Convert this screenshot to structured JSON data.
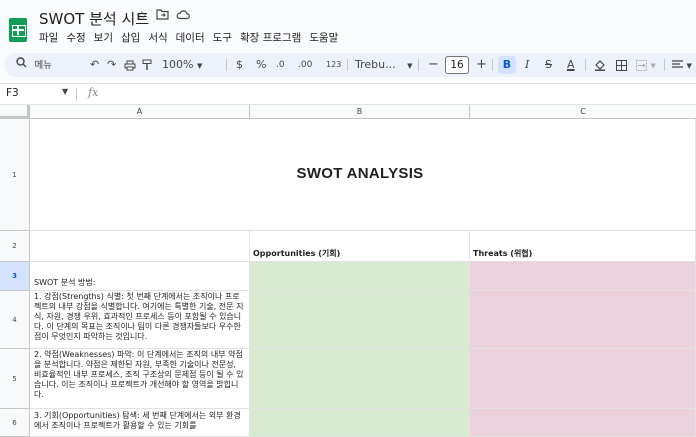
{
  "header": {
    "doc_title": "SWOT 분석 시트",
    "title_icons": [
      "star-icon",
      "move-to-folder-icon",
      "cloud-status-icon"
    ],
    "menu": [
      "파일",
      "수정",
      "보기",
      "삽입",
      "서식",
      "데이터",
      "도구",
      "확장 프로그램",
      "도움말"
    ]
  },
  "toolbar": {
    "search_label": "메뉴",
    "zoom": "100%",
    "currency": "$",
    "percent": "%",
    "decrease_decimal": ".0",
    "increase_decimal": ".00",
    "number_format": "123",
    "font": "Trebu...",
    "font_size": "16",
    "minus": "−",
    "plus": "+",
    "bold": "B",
    "italic": "I",
    "strike": "S",
    "text_color": "A"
  },
  "formula_bar": {
    "cell_ref": "F3",
    "fx": "fx",
    "content": ""
  },
  "columns": [
    "A",
    "B",
    "C"
  ],
  "rows": [
    "1",
    "2",
    "3",
    "4",
    "5",
    "6"
  ],
  "cells": {
    "title": "SWOT ANALYSIS",
    "b2": "Opportunities (기회)",
    "c2": "Threats (위협)",
    "a3": "SWOT  분석 방법:",
    "a4": "1. 강점(Strengths) 식별: 첫 번째 단계에서는 조직이나 프로젝트의 내부 강점을 식별합니다. 여기에는 특별한 기술, 전문 지식, 자원, 경쟁 우위, 효과적인 프로세스 등이 포함될 수 있습니다. 이 단계의 목표는 조직이나 팀이 다른 경쟁자들보다 우수한 점이 무엇인지 파악하는 것입니다.",
    "a5": "2. 약점(Weaknesses) 파악: 이 단계에서는 조직의 내부 약점을 분석합니다. 약점은 제한된 자원, 부족한 기술이나 전문성, 비효율적인 내부 프로세스, 조직 구조상의 문제점 등이 될 수 있습니다. 이는 조직이나 프로젝트가 개선해야 할 영역을 밝힙니다.",
    "a6": "3. 기회(Opportunities) 탐색: 세 번째 단계에서는 외부 환경에서 조직이나 프로젝트가 활용할 수 있는 기회를"
  },
  "colors": {
    "green": "#d9ead3",
    "pink": "#ead1dc",
    "app_green": "#0f9d58"
  }
}
